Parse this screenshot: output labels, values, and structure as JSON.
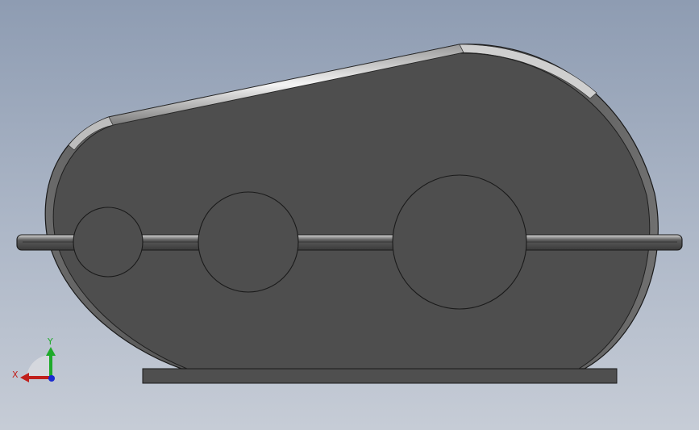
{
  "viewport": {
    "background_top": "#8e9cb2",
    "background_bottom": "#c6ccd6"
  },
  "model": {
    "body_color": "#4e4e4e",
    "rim_color": "#5a5a5a",
    "edge_color": "#1a1a1a",
    "highlight_color": "#e8e8e8",
    "flange_color": "#4a4a4a",
    "base_color": "#4f4f4f"
  },
  "triad": {
    "x_label": "X",
    "y_label": "Y",
    "x_color": "#c0201c",
    "y_color": "#1eaa2a",
    "z_color": "#1a2ad0"
  }
}
